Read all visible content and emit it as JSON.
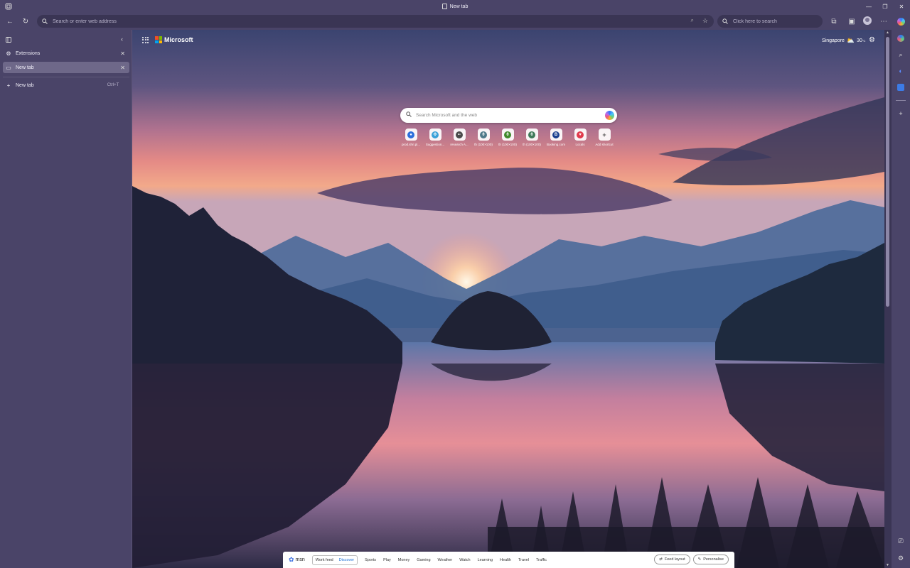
{
  "window": {
    "title": "New tab"
  },
  "toolbar": {
    "address_placeholder": "Search or enter web address",
    "side_search_placeholder": "Click here to search"
  },
  "sidebar": {
    "tabs": [
      {
        "label": "Extensions",
        "active": false
      },
      {
        "label": "New tab",
        "active": true
      }
    ],
    "new_tab": {
      "label": "New tab",
      "shortcut": "Ctrl+T"
    }
  },
  "page": {
    "brand": "Microsoft",
    "weather": {
      "location": "Singapore",
      "temp": "30",
      "unit": "°C"
    },
    "search_placeholder": "Search Microsoft and the web",
    "shortcuts": [
      {
        "label": "prod.shri.pl...",
        "icon": "cloud-icon",
        "color": "#2b6fdc",
        "glyph": "●"
      },
      {
        "label": "Suggestion...",
        "icon": "network-icon",
        "color": "#3aa0d8",
        "glyph": "✣"
      },
      {
        "label": "research A...",
        "icon": "research-icon",
        "color": "#4a4a4a",
        "glyph": "•-"
      },
      {
        "label": "th (100×100)",
        "icon": "th-icon",
        "color": "#4f7a8a",
        "glyph": "θ"
      },
      {
        "label": "th (100×100)",
        "icon": "th-icon",
        "color": "#3f8a2c",
        "glyph": "θ"
      },
      {
        "label": "th (100×100)",
        "icon": "th-icon",
        "color": "#3f7a5a",
        "glyph": "θ"
      },
      {
        "label": "Booking.com",
        "icon": "booking-icon",
        "color": "#1b3f8f",
        "glyph": "B"
      },
      {
        "label": "Locals",
        "icon": "heart-icon",
        "color": "#e03a4c",
        "glyph": "♥"
      },
      {
        "label": "Add shortcut",
        "icon": "plus-icon",
        "color": "#cfcfcf",
        "glyph": "+"
      }
    ]
  },
  "msn": {
    "logo": "msn",
    "feed_modes": [
      "Work feed",
      "Discover"
    ],
    "selected_feed": "Discover",
    "nav": [
      "Sports",
      "Play",
      "Money",
      "Gaming",
      "Weather",
      "Watch",
      "Learning",
      "Health",
      "Travel",
      "Traffic"
    ],
    "feed_layout": "Feed layout",
    "personalise": "Personalise"
  },
  "colors": {
    "chrome": "#4a4468",
    "accent": "#1a6fd6"
  }
}
